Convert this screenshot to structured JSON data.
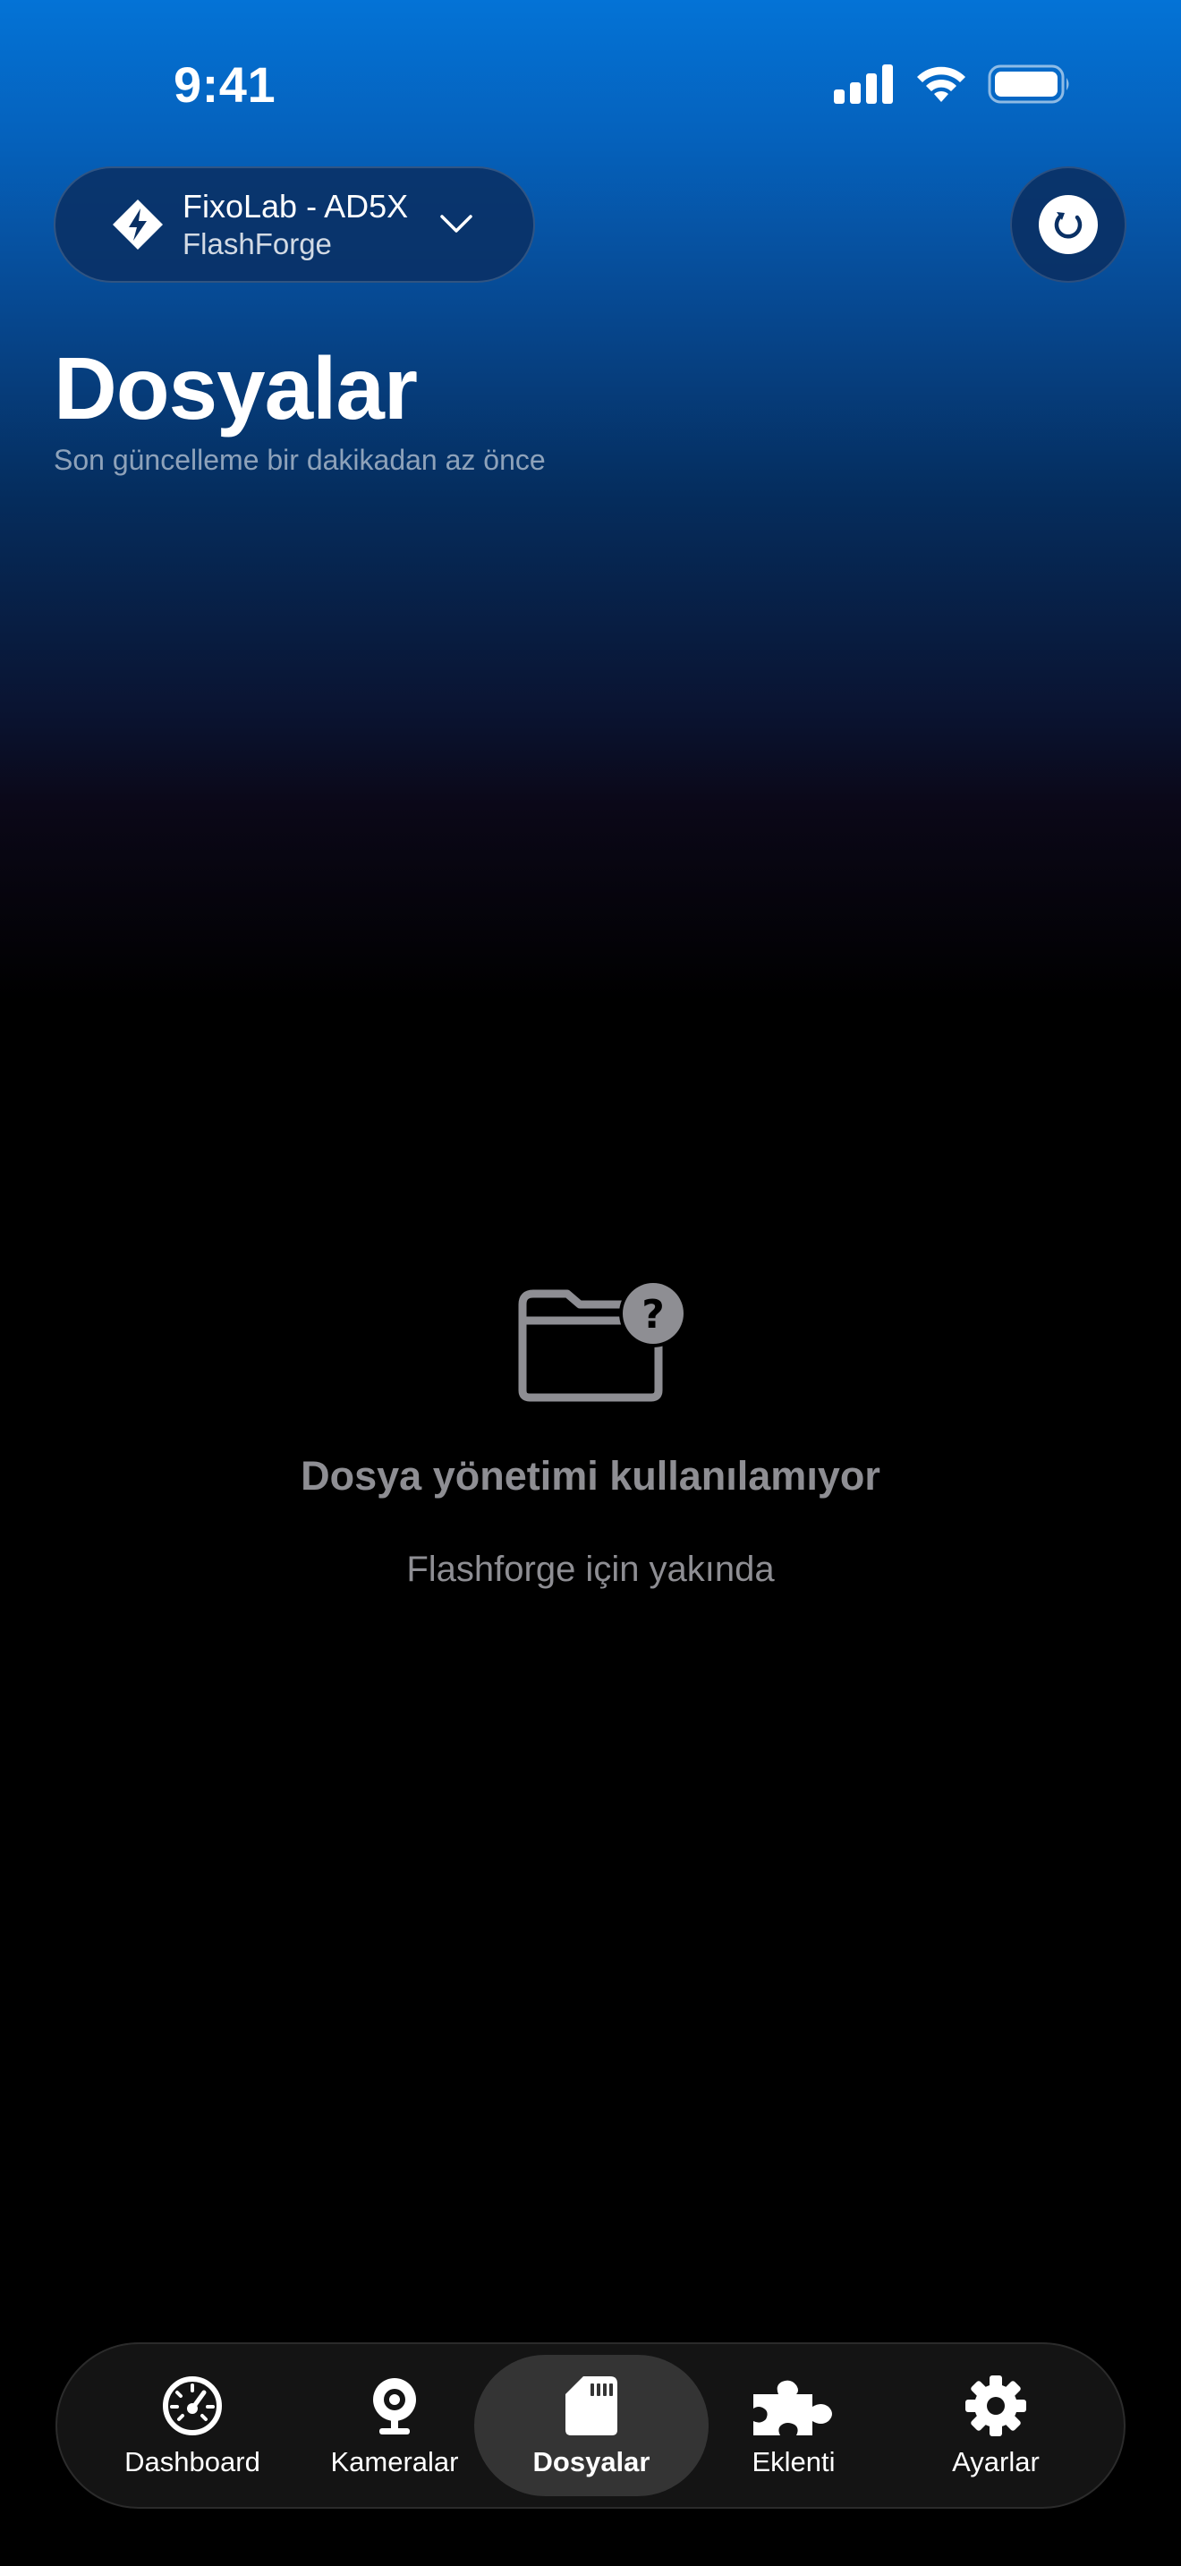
{
  "status_bar": {
    "time": "9:41",
    "icons": [
      "cellular-signal-icon",
      "wifi-icon",
      "battery-icon"
    ]
  },
  "header": {
    "printer_selector": {
      "name": "FixoLab - AD5X",
      "brand": "FlashForge",
      "logo_icon": "flashforge-logo-icon",
      "chevron_icon": "chevron-down-icon"
    },
    "refresh_icon": "refresh-icon",
    "title": "Dosyalar",
    "subtitle": "Son güncelleme bir dakikadan az önce"
  },
  "empty_state": {
    "icon": "folder-question-icon",
    "title": "Dosya yönetimi kullanılamıyor",
    "subtitle": "Flashforge için yakında"
  },
  "tab_bar": {
    "items": [
      {
        "label": "Dashboard",
        "icon": "speedometer-icon",
        "active": false
      },
      {
        "label": "Kameralar",
        "icon": "webcam-icon",
        "active": false
      },
      {
        "label": "Dosyalar",
        "icon": "sd-card-icon",
        "active": true
      },
      {
        "label": "Eklenti",
        "icon": "puzzle-icon",
        "active": false
      },
      {
        "label": "Ayarlar",
        "icon": "gear-icon",
        "active": false
      }
    ]
  },
  "colors": {
    "accent_blue": "#0473d6",
    "background": "#000000",
    "muted_text": "#8e8e93",
    "tab_bar": "#141414",
    "tab_active": "#343434"
  }
}
